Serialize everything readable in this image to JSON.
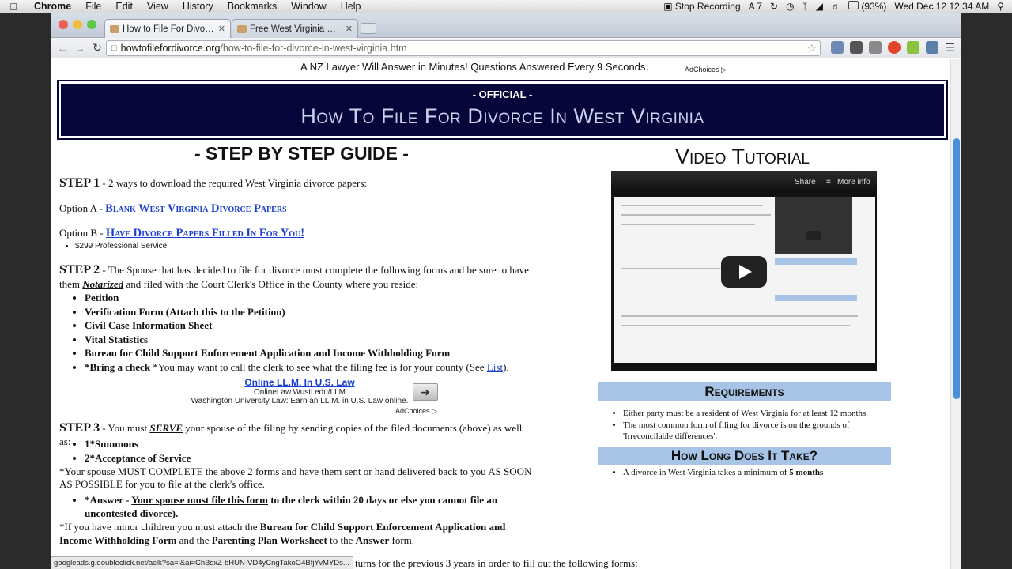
{
  "menubar": {
    "app": "Chrome",
    "items": [
      "File",
      "Edit",
      "View",
      "History",
      "Bookmarks",
      "Window",
      "Help"
    ],
    "stop_recording": "Stop Recording",
    "adobe_count": "7",
    "battery": "(93%)",
    "clock": "Wed Dec 12  12:34 AM"
  },
  "tabs": [
    {
      "title": "How to File For Divorce in W",
      "active": true
    },
    {
      "title": "Free West Virginia Divorce P",
      "active": false
    }
  ],
  "address": {
    "host": "howtofilefordivorce.org",
    "path": "/how-to-file-for-divorce-in-west-virginia.htm"
  },
  "page": {
    "top_ad": "A NZ Lawyer Will Answer in Minutes! Questions Answered Every 9 Seconds.",
    "adchoices": "AdChoices",
    "banner_official": "- OFFICIAL -",
    "banner_title": "How To File For Divorce In West Virginia",
    "guide_title": "- STEP BY STEP GUIDE -",
    "step1_label": "STEP 1",
    "step1_text": " - 2 ways to download the required West Virginia divorce papers:",
    "optionA_label": "Option A - ",
    "optionA_link": "Blank West Virginia Divorce Papers",
    "optionB_label": "Option B - ",
    "optionB_link": "Have Divorce Papers Filled In For You!",
    "optionB_price": "$299 Professional Service",
    "step2_label": "STEP 2",
    "step2_text_a": " - The Spouse that has decided to file for divorce must complete the following forms and be sure to have them ",
    "step2_notarized": "Notarized",
    "step2_text_b": " and filed with the Court Clerk's Office in the County where you reside:",
    "step2_items": [
      "Petition",
      "Verification Form (Attach this to the Petition)",
      "Civil Case Information Sheet",
      "Vital Statistics",
      "Bureau for Child Support Enforcement Application and Income Withholding Form"
    ],
    "check_bold": "*Bring a check",
    "check_text": " *You may want to call the clerk to see what the filing fee is for your county (See ",
    "check_link": "List",
    "check_end": ").",
    "mid_ad_title": "Online LL.M. In U.S. Law",
    "mid_ad_url": "OnlineLaw.Wustl.edu/LLM",
    "mid_ad_desc": "Washington University Law:  Earn an LL.M. in U.S. Law online.",
    "step3_label": "STEP 3",
    "step3_text_a": " - You must ",
    "step3_serve": "SERVE",
    "step3_text_b": " your spouse of the filing by sending copies of the filed documents (above) as well as:",
    "step3_items": [
      "1*Summons",
      "2*Acceptance of Service"
    ],
    "step3_note": "*Your spouse MUST COMPLETE the above 2 forms and have them sent or hand delivered back to you AS SOON AS POSSIBLE for you to file at the clerk's office.",
    "answer_bold": "*Answer - ",
    "answer_link": "Your spouse must file this form",
    "answer_rest": " to the clerk within 20 days or else you cannot file an uncontested divorce).",
    "minor_a": "*If you have minor children you must attach the ",
    "minor_b": "Bureau for Child Support Enforcement Application and Income Withholding Form",
    "minor_c": " and the ",
    "minor_d": "Parenting Plan Worksheet",
    "minor_e": " to the ",
    "minor_f": "Answer",
    "minor_g": " form.",
    "cut_text": "turns for the previous 3 years in order to fill out the following forms:",
    "video_title": "Video Tutorial",
    "video_share": "Share",
    "video_more": "More info",
    "req_title": "Requirements",
    "req_items": [
      "Either party must be a resident of West Virginia for at least 12 months.",
      "The most common form of filing for divorce is on the grounds of 'Irreconcilable differences'."
    ],
    "howlong_title": "How Long Does It Take?",
    "howlong_text": "A divorce in West Virginia takes a minimum of ",
    "howlong_bold": "5 months"
  },
  "statusbar": "googleads.g.doubleclick.net/aclk?sa=l&ai=ChBsxZ-bHUN-VD4yCngTakoG4BfjYvMYDs..."
}
